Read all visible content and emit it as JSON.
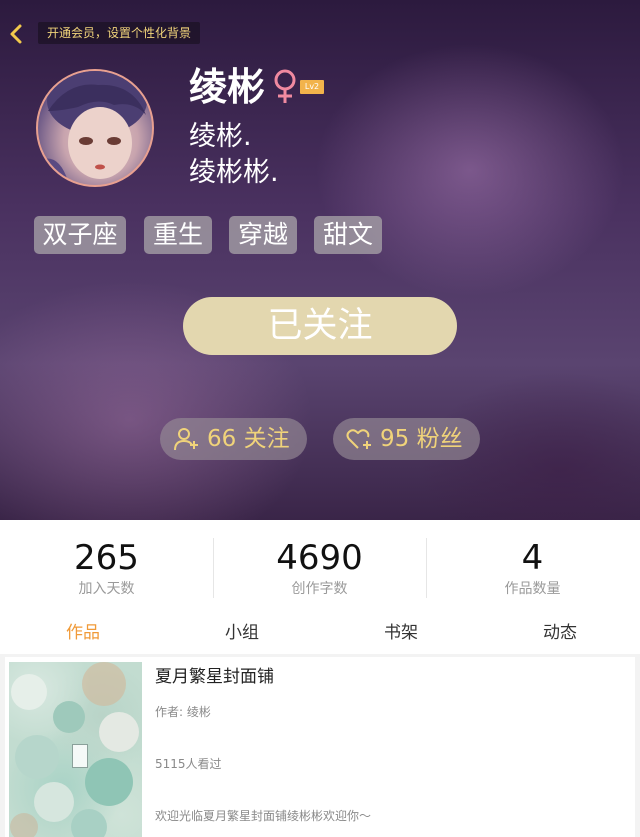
{
  "top_bar": {
    "back_icon": "chevron-left-icon",
    "vip_banner": "开通会员，设置个性化背景"
  },
  "profile": {
    "name": "绫彬",
    "gender_icon": "female-icon",
    "level": "Lv2",
    "subnames": [
      "绫彬.",
      "绫彬彬."
    ],
    "tags": [
      "双子座",
      "重生",
      "穿越",
      "甜文"
    ],
    "follow_button": "已关注",
    "following": {
      "icon": "add-user-icon",
      "label": "66 关注"
    },
    "fans": {
      "icon": "heart-plus-icon",
      "label": "95 粉丝"
    }
  },
  "stats": [
    {
      "value": "265",
      "label": "加入天数"
    },
    {
      "value": "4690",
      "label": "创作字数"
    },
    {
      "value": "4",
      "label": "作品数量"
    }
  ],
  "tabs": [
    "作品",
    "小组",
    "书架",
    "动态"
  ],
  "active_tab": "作品",
  "works": [
    {
      "title": "夏月繁星封面铺",
      "author": "作者: 绫彬",
      "views": "5115人看过",
      "description": "欢迎光临夏月繁星封面铺绫彬彬欢迎你～"
    }
  ],
  "colors": {
    "accent_gold": "#f0d37a",
    "follow_button": "#e3d7af",
    "active_tab": "#f09a38",
    "level_badge": "#f2b34b",
    "gender": "#f08aa0"
  }
}
